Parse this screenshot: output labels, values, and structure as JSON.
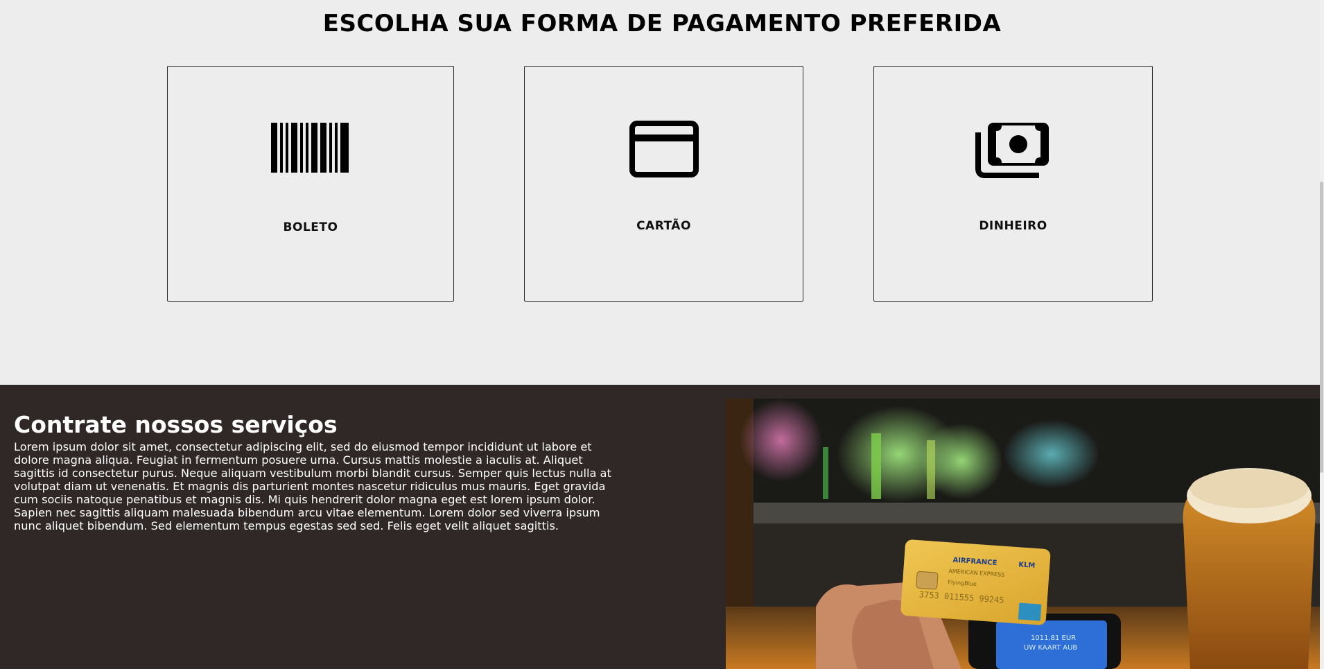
{
  "payment": {
    "title": "ESCOLHA SUA FORMA DE PAGAMENTO PREFERIDA",
    "options": [
      {
        "label": "BOLETO",
        "icon": "barcode-icon"
      },
      {
        "label": "CARTÃO",
        "icon": "credit-card-icon"
      },
      {
        "label": "DINHEIRO",
        "icon": "money-bills-icon"
      }
    ]
  },
  "services": {
    "title": "Contrate nossos serviços",
    "text": "Lorem ipsum dolor sit amet, consectetur adipiscing elit, sed do eiusmod tempor incididunt ut labore et dolore magna aliqua. Feugiat in fermentum posuere urna. Cursus mattis molestie a iaculis at. Aliquet sagittis id consectetur purus. Neque aliquam vestibulum morbi blandit cursus. Semper quis lectus nulla at volutpat diam ut venenatis. Et magnis dis parturient montes nascetur ridiculus mus mauris. Eget gravida cum sociis natoque penatibus et magnis dis. Mi quis hendrerit dolor magna eget est lorem ipsum dolor. Sapien nec sagittis aliquam malesuada bibendum arcu vitae elementum. Lorem dolor sed viverra ipsum nunc aliquet bibendum. Sed elementum tempus egestas sed sed. Felis eget velit aliquet sagittis.",
    "photo": {
      "card_brand": "AIRFRANCE",
      "card_brand2": "KLM",
      "card_issuer": "AMERICAN EXPRESS",
      "card_program": "FlyingBlue",
      "card_number": "3753 011555 99245",
      "terminal_amount": "1011,81 EUR",
      "terminal_text": "UW KAART AUB"
    }
  },
  "colors": {
    "payment_bg": "#eeeded",
    "services_bg": "#2f2827",
    "card_yellow": "#e6b63a"
  }
}
